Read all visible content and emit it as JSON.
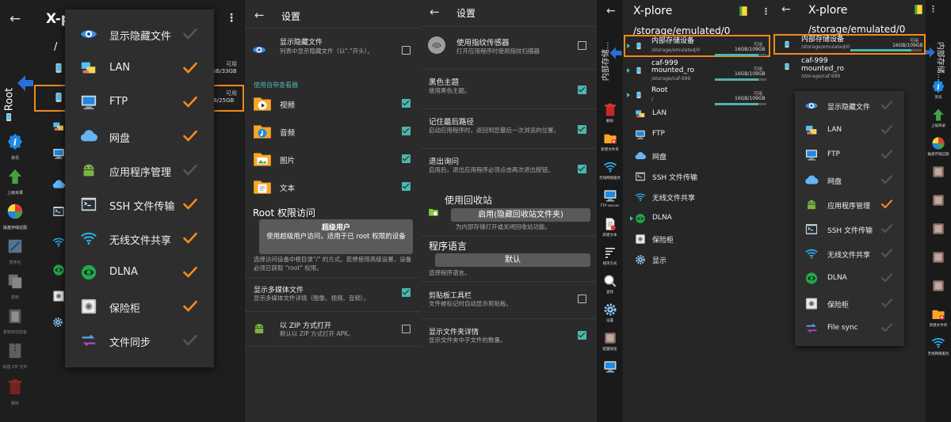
{
  "panel1": {
    "app_title": "X-p",
    "path": "/",
    "side_root_label": "Root",
    "avail1": "可用",
    "size1": "GB/33GB",
    "avail2": "可用",
    "size2": "B/25GB",
    "toolbar": [
      {
        "label": "资讯",
        "icon": "info-icon"
      },
      {
        "label": "上级目录",
        "icon": "up-arrow-icon"
      },
      {
        "label": "磁盘存储这图",
        "icon": "disk-map-icon"
      },
      {
        "label": "重命名",
        "icon": "rename-icon"
      },
      {
        "label": "复制",
        "icon": "copy-icon"
      },
      {
        "label": "复制到剪贴板",
        "icon": "clipboard-icon"
      },
      {
        "label": "新建 ZIP 文件",
        "icon": "zip-icon"
      },
      {
        "label": "删除",
        "icon": "trash-icon"
      }
    ],
    "menu": [
      {
        "label": "显示隐藏文件",
        "icon": "eye-icon",
        "checked": false
      },
      {
        "label": "LAN",
        "icon": "lan-icon",
        "checked": true
      },
      {
        "label": "FTP",
        "icon": "ftp-icon",
        "checked": true
      },
      {
        "label": "网盘",
        "icon": "cloud-icon",
        "checked": true
      },
      {
        "label": "应用程序管理",
        "icon": "android-icon",
        "checked": false
      },
      {
        "label": "SSH 文件传输",
        "icon": "terminal-icon",
        "checked": true
      },
      {
        "label": "无线文件共享",
        "icon": "wifi-icon",
        "checked": true
      },
      {
        "label": "DLNA",
        "icon": "dlna-icon",
        "checked": true
      },
      {
        "label": "保险柜",
        "icon": "vault-icon",
        "checked": true
      },
      {
        "label": "文件同步",
        "icon": "sync-icon",
        "checked": false
      }
    ]
  },
  "panel2": {
    "title": "设置",
    "hidden_title": "显示隐藏文件",
    "hidden_sub": "列表中显示隐藏文件（以\".\"开头）。",
    "viewer_header": "使用自带查看器",
    "viewers": [
      {
        "label": "视频",
        "checked": true
      },
      {
        "label": "音频",
        "checked": true
      },
      {
        "label": "图片",
        "checked": true
      },
      {
        "label": "文本",
        "checked": true
      }
    ],
    "root_header": "Root 权限访问",
    "su_title": "超级用户",
    "su_text": "使用超级用户访问，适用于已 root 权限的设备",
    "root_note": "选择访问设备中根目录\"/\" 的方式。若想使用高级设置，设备必须已获取 \"root\" 权限。",
    "media_title": "显示多媒体文件",
    "media_sub": "显示多媒体文件详情（图像、视频、音频）。",
    "zip_title": "以 ZIP 方式打开",
    "zip_sub": "默认以 ZIP 方式打开 APK。"
  },
  "panel3": {
    "title": "设置",
    "items": [
      {
        "title": "使用指纹传感器",
        "sub": "打开应用程序时使用指纹扫描器",
        "checked": false
      },
      {
        "title": "黑色主题",
        "sub": "使用黑色主题。",
        "checked": true
      },
      {
        "title": "记住最后路径",
        "sub": "启动应用程序时，返回到您最后一次浏览的位置。",
        "checked": true
      },
      {
        "title": "退出询问",
        "sub": "启用后，退出应用程序必须点击两次退出按钮。",
        "checked": true
      }
    ],
    "recycle_title": "使用回收站",
    "recycle_button": "启用(隐藏回收站文件夹)",
    "recycle_sub": "为内部存储打开或关闭回收站功能。",
    "lang_header": "程序语言",
    "lang_button": "默认",
    "lang_sub": "选择程序语言。",
    "clip_title": "剪贴板工具栏",
    "clip_sub": "文件被标记时自动显示剪贴板。",
    "folder_title": "显示文件夹详情",
    "folder_sub": "显示文件夹中子文件的数量。"
  },
  "panel4": {
    "app_title": "X-plore",
    "path": "/storage/emulated/0",
    "side_label": "内部存储...",
    "toolbar": [
      {
        "label": "删除",
        "icon": "trash-icon"
      },
      {
        "label": "新建文件夹",
        "icon": "new-folder-icon"
      },
      {
        "label": "无线网络服务",
        "icon": "wifi-server-icon"
      },
      {
        "label": "FTP server",
        "icon": "ftp-server-icon"
      },
      {
        "label": "新建文本",
        "icon": "new-text-icon"
      },
      {
        "label": "排序方式",
        "icon": "sort-icon"
      },
      {
        "label": "查找",
        "icon": "find-icon"
      },
      {
        "label": "设置",
        "icon": "settings-icon"
      },
      {
        "label": "配置按钮",
        "icon": "config-buttons-icon"
      },
      {
        "label": "",
        "icon": "window-icon"
      }
    ],
    "rows": [
      {
        "name": "内部存储设备",
        "path": "/storage/emulated/0",
        "avail": "可用",
        "size": "16GB/109GB",
        "fill": 0.85
      },
      {
        "name": "caf-999\nmounted_ro",
        "path": "/storage/caf-999",
        "avail": "可用",
        "size": "16GB/109GB",
        "fill": 0.85
      },
      {
        "name": "Root",
        "path": "/",
        "avail": "可用",
        "size": "16GB/109GB",
        "fill": 0.85
      }
    ],
    "tree": [
      {
        "label": "LAN",
        "icon": "lan-icon"
      },
      {
        "label": "FTP",
        "icon": "ftp-icon"
      },
      {
        "label": "网盘",
        "icon": "cloud-icon"
      },
      {
        "label": "SSH 文件传输",
        "icon": "terminal-icon"
      },
      {
        "label": "无线文件共享",
        "icon": "wifi-icon"
      },
      {
        "label": "DLNA",
        "icon": "dlna-icon"
      },
      {
        "label": "保险柜",
        "icon": "vault-icon"
      },
      {
        "label": "显示",
        "icon": "gear-icon"
      }
    ]
  },
  "panel5": {
    "app_title": "X-plore",
    "path": "/storage/emulated/0",
    "side_label": "内部存储...",
    "rows": [
      {
        "name": "内部存储设备",
        "path": "/storage/emulated/0",
        "avail": "可用",
        "size": "16GB/109GB"
      },
      {
        "name": "caf-999\nmounted_ro",
        "path": "/storage/caf-999",
        "avail": "",
        "size": ""
      }
    ],
    "toolbar": [
      {
        "label": "资讯",
        "icon": "info-icon"
      },
      {
        "label": "上级目录",
        "icon": "up-arrow-icon"
      },
      {
        "label": "磁盘存储这图",
        "icon": "disk-map-icon"
      },
      {
        "label": "",
        "icon": "rename-icon"
      },
      {
        "label": "",
        "icon": "copy-icon"
      },
      {
        "label": "",
        "icon": "clipboard-icon"
      },
      {
        "label": "",
        "icon": "zip-icon"
      },
      {
        "label": "",
        "icon": "extra-icon"
      },
      {
        "label": "新建文件夹",
        "icon": "new-folder-icon"
      },
      {
        "label": "无线网络服务",
        "icon": "wifi-server-icon"
      }
    ],
    "menu": [
      {
        "label": "显示隐藏文件",
        "icon": "eye-icon",
        "checked": false
      },
      {
        "label": "LAN",
        "icon": "lan-icon",
        "checked": false
      },
      {
        "label": "FTP",
        "icon": "ftp-icon",
        "checked": false
      },
      {
        "label": "网盘",
        "icon": "cloud-icon",
        "checked": false
      },
      {
        "label": "应用程序管理",
        "icon": "android-icon",
        "checked": true
      },
      {
        "label": "SSH 文件传输",
        "icon": "terminal-icon",
        "checked": false
      },
      {
        "label": "无线文件共享",
        "icon": "wifi-icon",
        "checked": false
      },
      {
        "label": "DLNA",
        "icon": "dlna-icon",
        "checked": false
      },
      {
        "label": "保险柜",
        "icon": "vault-icon",
        "checked": false
      },
      {
        "label": "File sync",
        "icon": "sync-icon",
        "checked": false
      }
    ]
  },
  "colors": {
    "accent": "#f08a1c",
    "teal": "#4db6ac",
    "blue_arrow": "#2b6fd6"
  }
}
